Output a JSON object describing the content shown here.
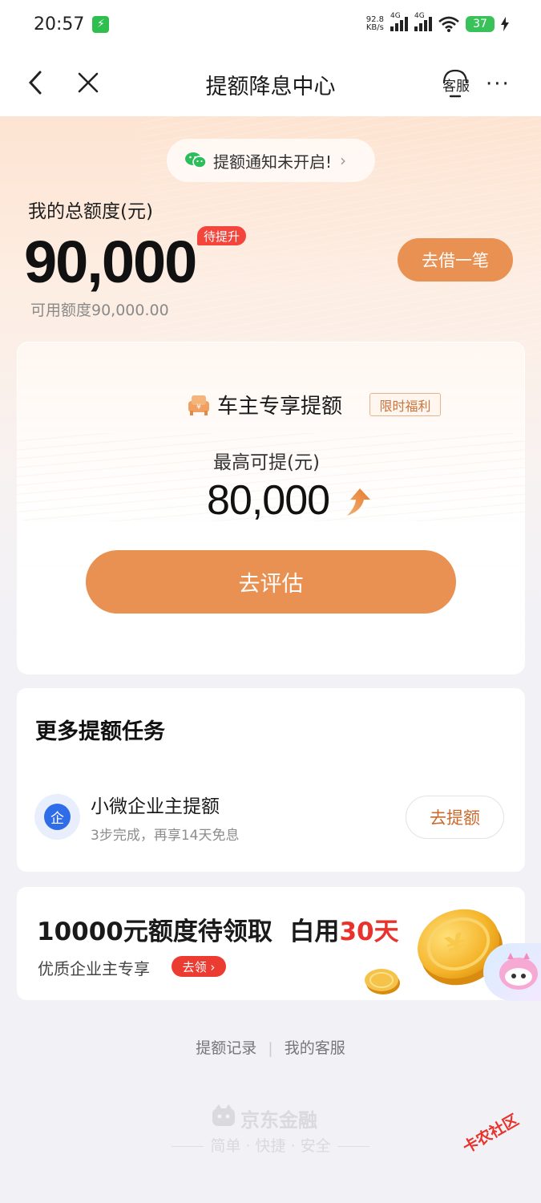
{
  "status_bar": {
    "time": "20:57",
    "net_speed": "92.8",
    "net_unit": "KB/s",
    "signal1": "4G",
    "signal2": "4G",
    "battery": "37"
  },
  "nav": {
    "title": "提额降息中心",
    "service_label": "客服",
    "more": "···"
  },
  "hero": {
    "notify_text": "提额通知未开启!",
    "total_label": "我的总额度(元)",
    "total_amount": "90,000",
    "pending_badge": "待提升",
    "available_text": "可用额度90,000.00",
    "borrow_button": "去借一笔"
  },
  "car_card": {
    "title": "车主专享提额",
    "tag": "限时福利",
    "max_label": "最高可提(元)",
    "max_amount": "80,000",
    "eval_button": "去评估"
  },
  "tasks": {
    "title": "更多提额任务",
    "items": [
      {
        "icon_text": "企",
        "name": "小微企业主提额",
        "desc": "3步完成，再享14天免息",
        "button": "去提额"
      }
    ]
  },
  "promo": {
    "main_prefix": "10000元额度待领取  白用",
    "main_highlight": "30天",
    "sub": "优质企业主专享",
    "tag": "去领 ›"
  },
  "footer": {
    "link_records": "提额记录",
    "separator": "|",
    "link_service": "我的客服",
    "brand_name": "京东金融",
    "slogan": "简单 · 快捷 · 安全"
  },
  "watermark": "卡农社区",
  "colors": {
    "accent_orange": "#e99152",
    "red": "#e8322b",
    "task_blue": "#2f6de8"
  }
}
